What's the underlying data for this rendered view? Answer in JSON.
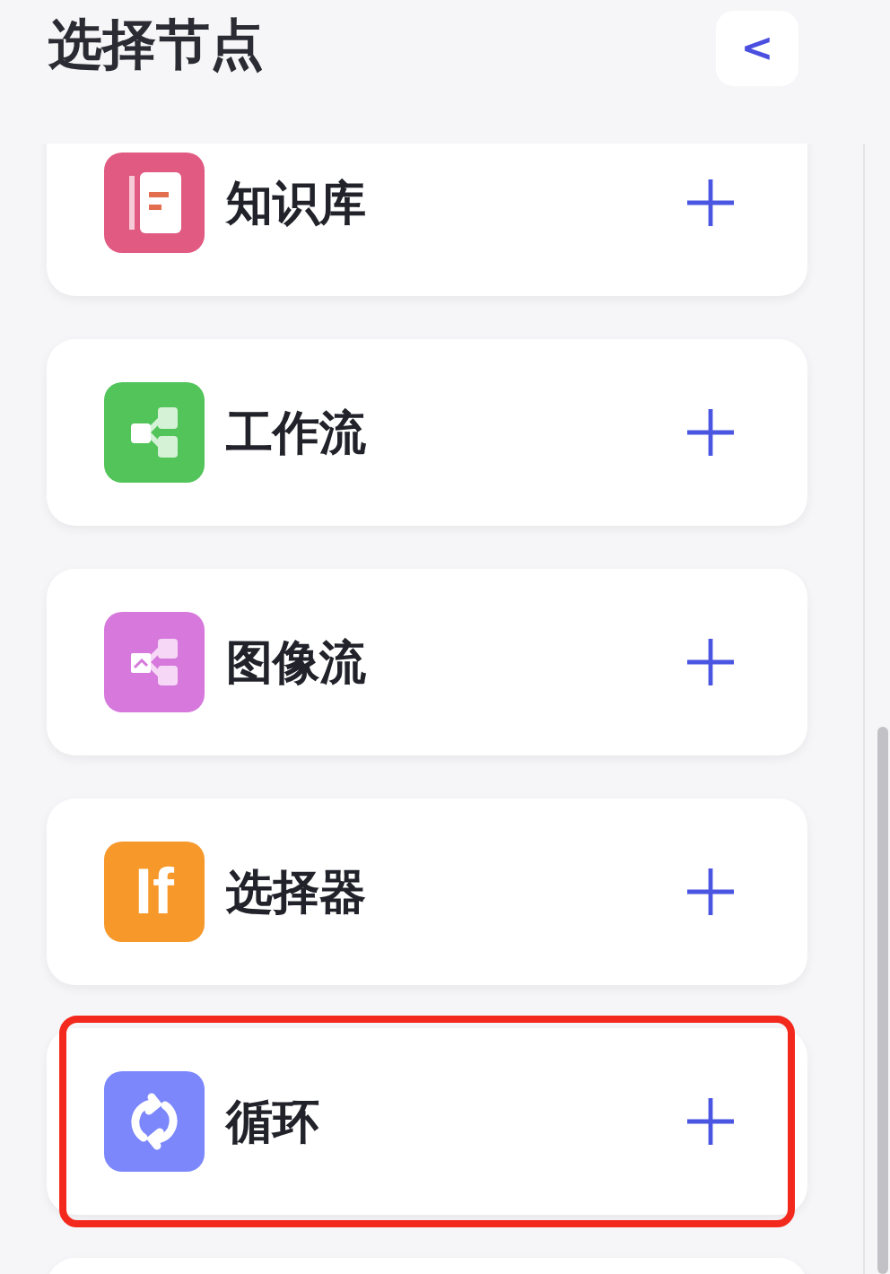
{
  "header": {
    "title": "选择节点",
    "back_button": "<"
  },
  "nodes": [
    {
      "kind": "knowledge",
      "label": "知识库",
      "color": "#e05a82",
      "highlighted": false
    },
    {
      "kind": "workflow",
      "label": "工作流",
      "color": "#52c45a",
      "highlighted": false
    },
    {
      "kind": "imageflow",
      "label": "图像流",
      "color": "#d778dd",
      "highlighted": false
    },
    {
      "kind": "selector",
      "label": "选择器",
      "icon_text": "If",
      "color": "#f7982a",
      "highlighted": false
    },
    {
      "kind": "loop",
      "label": "循环",
      "color": "#7b87fb",
      "highlighted": true
    },
    {
      "kind": "blank",
      "highlighted": false
    }
  ]
}
